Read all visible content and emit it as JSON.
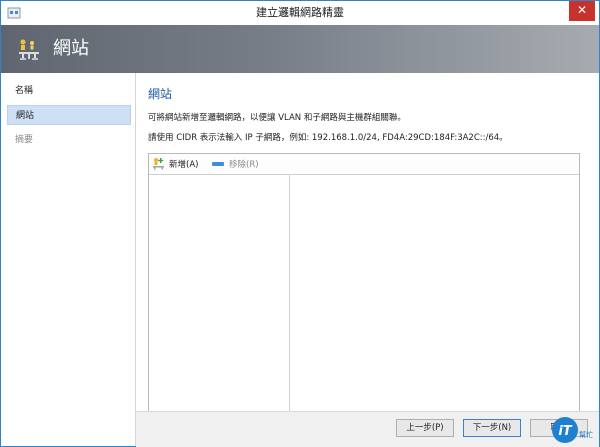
{
  "window": {
    "title": "建立邏輯網路精靈",
    "close_glyph": "✕"
  },
  "header": {
    "title": "網站"
  },
  "nav": {
    "items": [
      {
        "label": "名稱"
      },
      {
        "label": "網站"
      },
      {
        "label": "摘要"
      }
    ]
  },
  "content": {
    "title": "網站",
    "desc1": "可將網站新增至邏輯網路，以便讓 VLAN 和子網路與主機群組關聯。",
    "desc2": "請使用 CIDR 表示法輸入 IP 子網路，例如: 192.168.1.0/24, FD4A:29CD:184F:3A2C::/64。"
  },
  "toolbar": {
    "add_label": "新增(A)",
    "remove_label": "移除(R)"
  },
  "buttons": {
    "prev": "上一步(P)",
    "next": "下一步(N)",
    "cancel": "取消"
  },
  "logo": {
    "text": "iT",
    "subtext": "幫忙"
  },
  "colors": {
    "accent": "#1d5aa5",
    "close": "#c7322b",
    "selection": "#cfe0f5"
  }
}
